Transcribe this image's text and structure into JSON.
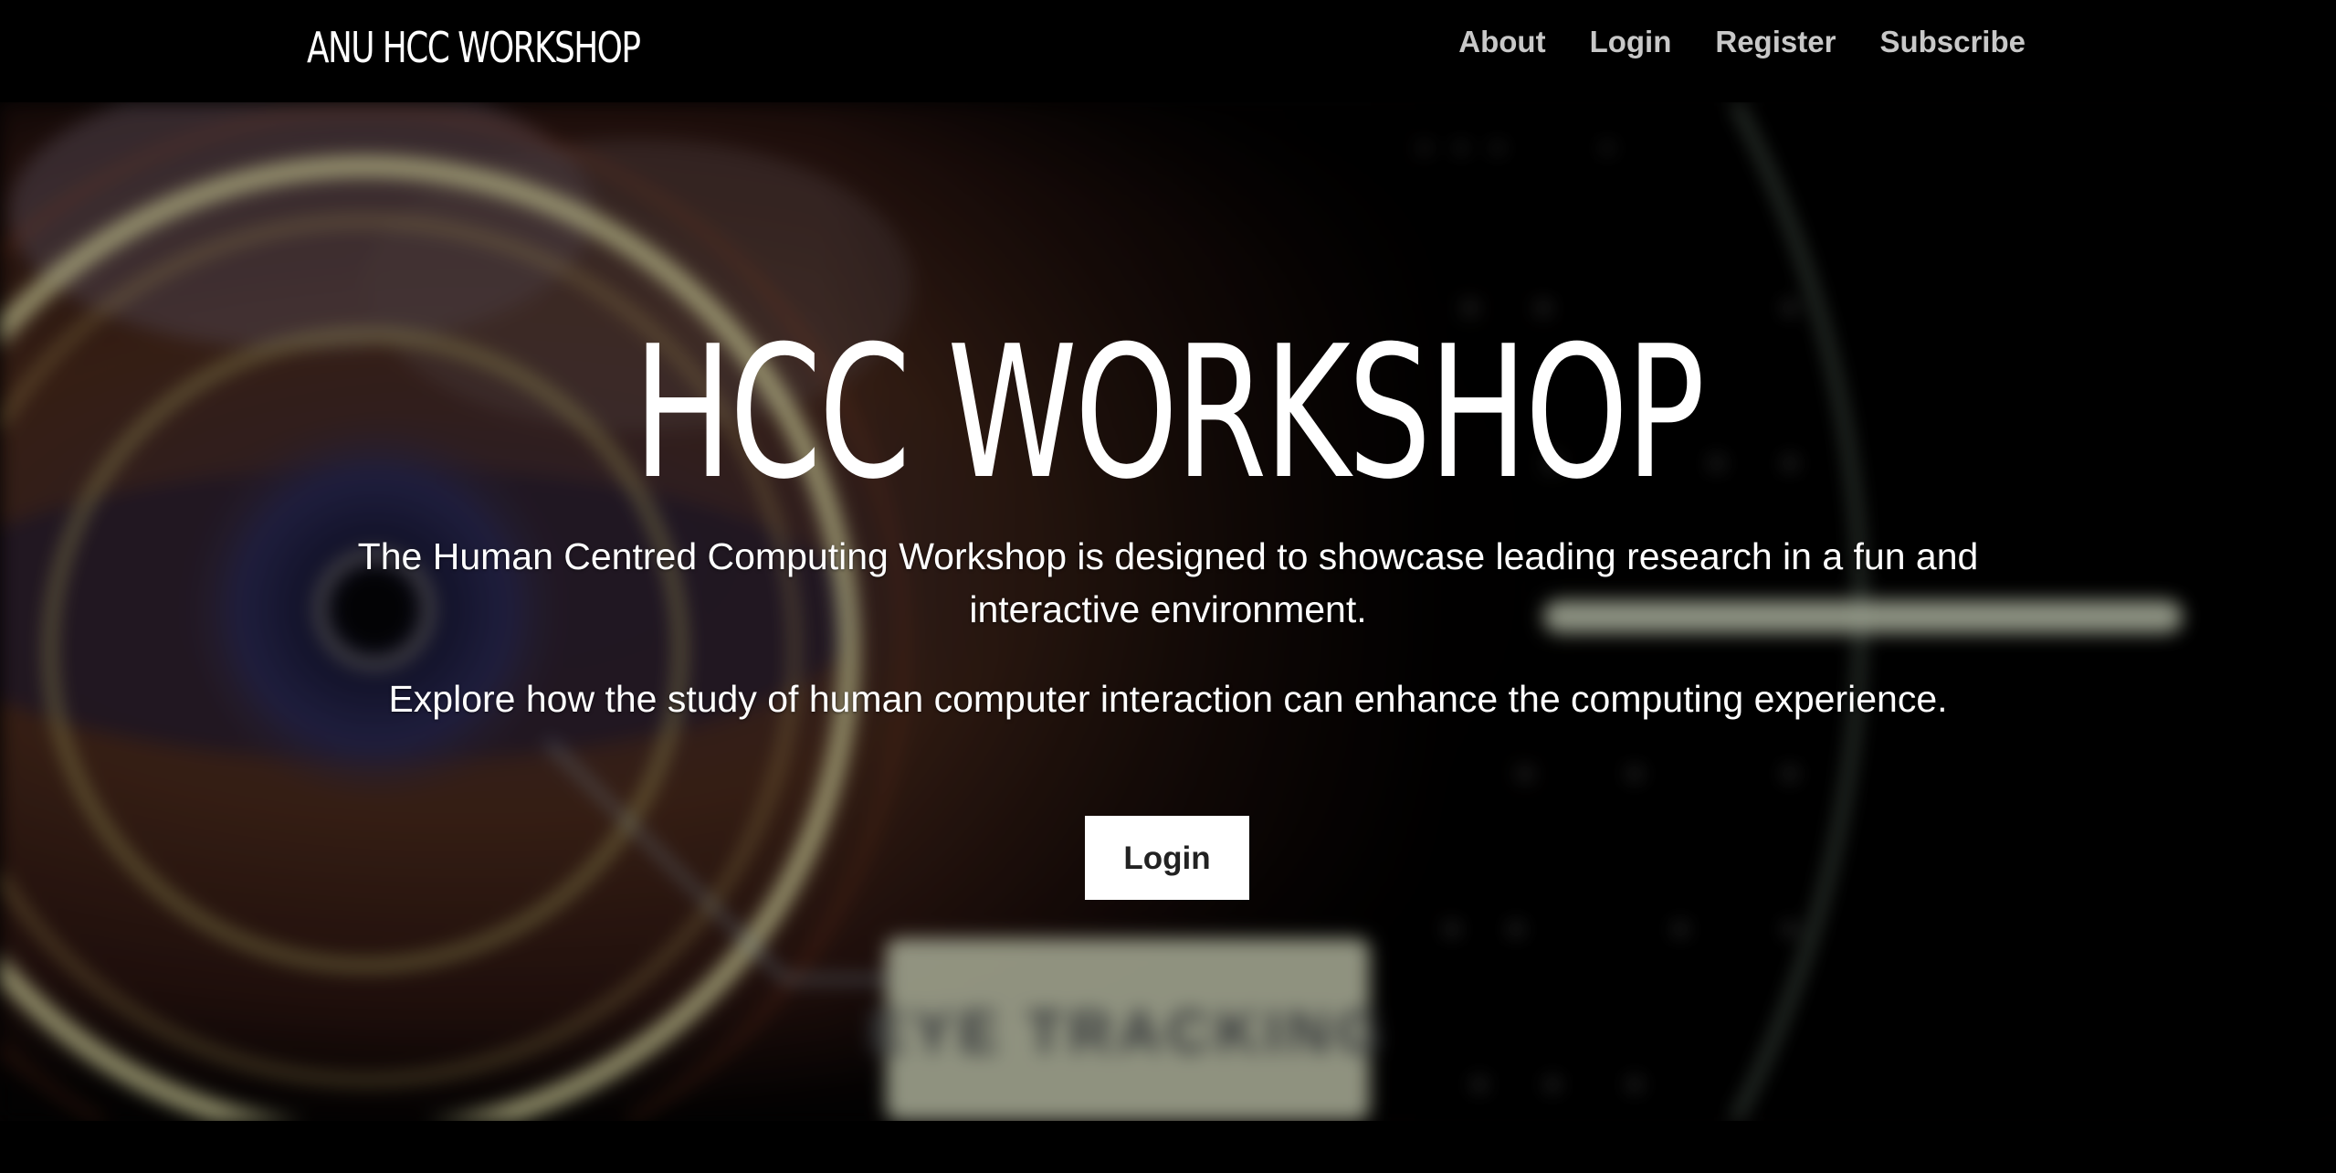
{
  "navbar": {
    "brand": "ANU HCC WORKSHOP",
    "links": [
      {
        "label": "About"
      },
      {
        "label": "Login"
      },
      {
        "label": "Register"
      },
      {
        "label": "Subscribe"
      }
    ]
  },
  "hero": {
    "title": "HCC WORKSHOP",
    "paragraph_1": "The Human Centred Computing Workshop is designed to showcase leading research in a fun and interactive environment.",
    "paragraph_2": "Explore how the study of human computer interaction can enhance the computing experience.",
    "cta_label": "Login",
    "background_caption": "EYE TRACKING"
  },
  "colors": {
    "background": "#000000",
    "nav_link": "#c8c8c8",
    "text": "#ffffff",
    "ring_glow": "#e8e6a0",
    "button_bg": "#ffffff",
    "button_text": "#222222"
  }
}
